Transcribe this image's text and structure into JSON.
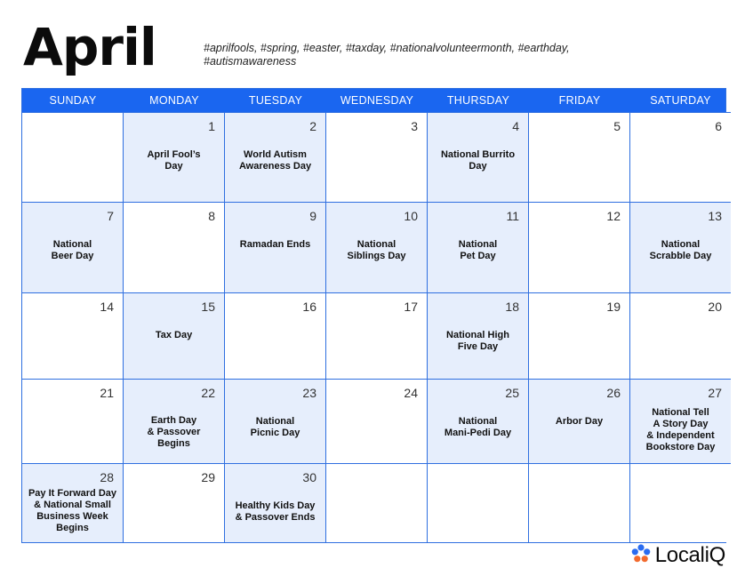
{
  "month": "April",
  "hashtags": "#aprilfools, #spring, #easter, #taxday, #nationalvolunteermonth, #earthday, #autismawareness",
  "weekdays": [
    "SUNDAY",
    "MONDAY",
    "TUESDAY",
    "WEDNESDAY",
    "THURSDAY",
    "FRIDAY",
    "SATURDAY"
  ],
  "weeks": [
    [
      {
        "day": "",
        "events": [],
        "highlight": false
      },
      {
        "day": "1",
        "events": [
          "April Fool’s",
          "Day"
        ],
        "highlight": true
      },
      {
        "day": "2",
        "events": [
          "World Autism",
          "Awareness Day"
        ],
        "highlight": true
      },
      {
        "day": "3",
        "events": [],
        "highlight": false
      },
      {
        "day": "4",
        "events": [
          "National Burrito",
          "Day"
        ],
        "highlight": true
      },
      {
        "day": "5",
        "events": [],
        "highlight": false
      },
      {
        "day": "6",
        "events": [],
        "highlight": false
      }
    ],
    [
      {
        "day": "7",
        "events": [
          "National",
          "Beer Day"
        ],
        "highlight": true
      },
      {
        "day": "8",
        "events": [],
        "highlight": false
      },
      {
        "day": "9",
        "events": [
          "Ramadan Ends"
        ],
        "highlight": true
      },
      {
        "day": "10",
        "events": [
          "National",
          "Siblings Day"
        ],
        "highlight": true
      },
      {
        "day": "11",
        "events": [
          "National",
          "Pet Day"
        ],
        "highlight": true
      },
      {
        "day": "12",
        "events": [],
        "highlight": false
      },
      {
        "day": "13",
        "events": [
          "National",
          "Scrabble Day"
        ],
        "highlight": true
      }
    ],
    [
      {
        "day": "14",
        "events": [],
        "highlight": false
      },
      {
        "day": "15",
        "events": [
          "Tax Day"
        ],
        "highlight": true
      },
      {
        "day": "16",
        "events": [],
        "highlight": false
      },
      {
        "day": "17",
        "events": [],
        "highlight": false
      },
      {
        "day": "18",
        "events": [
          "National High",
          "Five Day"
        ],
        "highlight": true
      },
      {
        "day": "19",
        "events": [],
        "highlight": false
      },
      {
        "day": "20",
        "events": [],
        "highlight": false
      }
    ],
    [
      {
        "day": "21",
        "events": [],
        "highlight": false
      },
      {
        "day": "22",
        "events": [
          "Earth Day",
          "& Passover",
          "Begins"
        ],
        "highlight": true
      },
      {
        "day": "23",
        "events": [
          "National",
          "Picnic Day"
        ],
        "highlight": true
      },
      {
        "day": "24",
        "events": [],
        "highlight": false
      },
      {
        "day": "25",
        "events": [
          "National",
          "Mani-Pedi Day"
        ],
        "highlight": true
      },
      {
        "day": "26",
        "events": [
          "Arbor Day"
        ],
        "highlight": true
      },
      {
        "day": "27",
        "events": [
          "National Tell",
          "A Story Day",
          "& Independent",
          "Bookstore Day"
        ],
        "highlight": true
      }
    ],
    [
      {
        "day": "28",
        "events": [
          "Pay It Forward Day",
          "& National Small",
          "Business Week",
          "Begins"
        ],
        "highlight": true
      },
      {
        "day": "29",
        "events": [],
        "highlight": false
      },
      {
        "day": "30",
        "events": [
          "Healthy Kids Day",
          "& Passover Ends"
        ],
        "highlight": true
      },
      {
        "day": "",
        "events": [],
        "highlight": false
      },
      {
        "day": "",
        "events": [],
        "highlight": false
      },
      {
        "day": "",
        "events": [],
        "highlight": false
      },
      {
        "day": "",
        "events": [],
        "highlight": false
      }
    ]
  ],
  "brand": {
    "name": "LocaliQ",
    "icon": "flower-logo-icon",
    "logo_colors": [
      "#2a6cf0",
      "#f26a2e"
    ]
  },
  "colors": {
    "header": "#1a66f0",
    "grid": "#2f6fe0",
    "highlight": "#e6eefc"
  }
}
